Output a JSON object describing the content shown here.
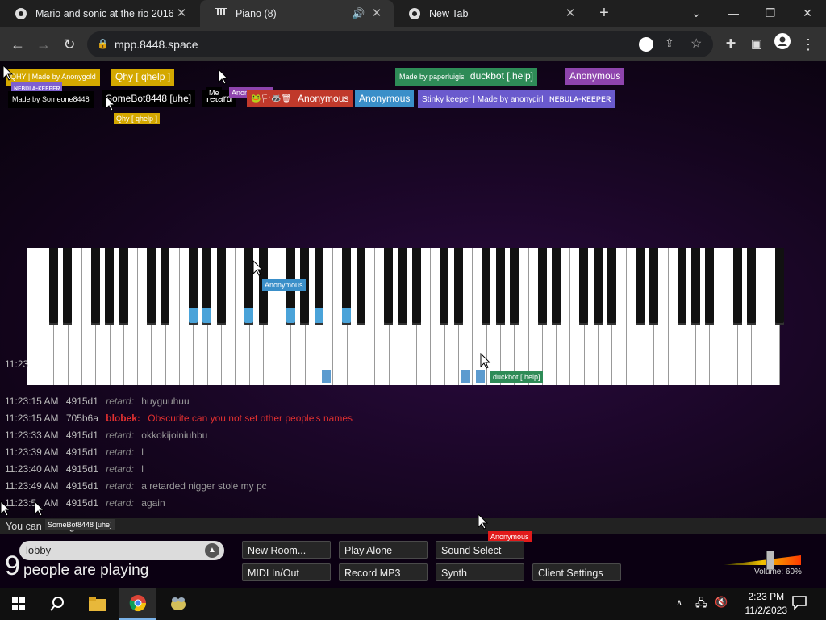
{
  "browser": {
    "tabs": [
      {
        "title": "Mario and sonic at the rio 2016 Olym"
      },
      {
        "title": "Piano (8)"
      },
      {
        "title": "New Tab"
      }
    ],
    "url": "mpp.8448.space"
  },
  "nametags": [
    {
      "text": "QHY | Made by Anonygold",
      "color": "#d4a800"
    },
    {
      "text": "Qhy [ qhelp ]",
      "color": "#d4a800"
    },
    {
      "text": "Made by paperluigis",
      "color": "#2e8b57"
    },
    {
      "text": "duckbot [.help]",
      "color": "#2e8b57"
    },
    {
      "text": "Anonymous",
      "color": "#8e44ad"
    },
    {
      "text": "Made by Someone8448",
      "color": "#000000"
    },
    {
      "text": "SomeBot8448 [uhe]",
      "color": "#000000"
    },
    {
      "text": "retard",
      "color": "#000000"
    },
    {
      "text": "🐸🏳🦝🗑",
      "color": "#c0392b"
    },
    {
      "text": "Anonymous",
      "color": "#c0392b"
    },
    {
      "text": "Anonymous",
      "color": "#3a8fc9"
    },
    {
      "text": "Stinky keeper | Made by anonygirl",
      "color": "#6a5acd"
    },
    {
      "text": "ɴᴇʙᴜʟᴀ-ᴋᴇᴇᴘᴇʀ",
      "color": "#6a5acd"
    }
  ],
  "cursor_tags": [
    {
      "text": "ɴᴇʙᴜʟᴀ-ᴋᴇᴇᴘᴇʀ",
      "color": "#7d5fd0"
    },
    {
      "text": "Me",
      "color": "#000000"
    },
    {
      "text": "Anonymous",
      "color": "#8e44ad"
    },
    {
      "text": "Qhy [ qhelp ]",
      "color": "#d4a800"
    },
    {
      "text": "Anonymous",
      "color": "#3a8fc9"
    },
    {
      "text": "duckbot [.help]",
      "color": "#2e8b57"
    },
    {
      "text": "SomeBot8448 [uhe]",
      "color": "#333333"
    },
    {
      "text": "Anonymous",
      "color": "#e21b1b"
    }
  ],
  "chat": [
    {
      "time": "11:23",
      "id": "",
      "name": "",
      "msg": ""
    },
    {
      "time": "11:23:15 AM",
      "id": "4915d1",
      "name": "retard:",
      "msg": "huyguuhuu",
      "name_color": "#888888",
      "msg_color": "#999999"
    },
    {
      "time": "11:23:15 AM",
      "id": "705b6a",
      "name": "blobek:",
      "msg": "Obscurite can you not set other people's names",
      "name_color": "#e03030",
      "msg_color": "#e03030"
    },
    {
      "time": "11:23:33 AM",
      "id": "4915d1",
      "name": "retard:",
      "msg": "okkokijoiniuhbu",
      "name_color": "#888888",
      "msg_color": "#999999"
    },
    {
      "time": "11:23:39 AM",
      "id": "4915d1",
      "name": "retard:",
      "msg": "l",
      "name_color": "#888888",
      "msg_color": "#999999"
    },
    {
      "time": "11:23:40 AM",
      "id": "4915d1",
      "name": "retard:",
      "msg": "l",
      "name_color": "#888888",
      "msg_color": "#999999"
    },
    {
      "time": "11:23:49 AM",
      "id": "4915d1",
      "name": "retard:",
      "msg": "a retarded nigger stole my pc",
      "name_color": "#888888",
      "msg_color": "#999999"
    },
    {
      "time": "11:23:5_ AM",
      "id": "4915d1",
      "name": "retard:",
      "msg": "again",
      "name_color": "#888888",
      "msg_color": "#999999"
    }
  ],
  "chat_hint": "You can ... hing.",
  "room": {
    "name": "lobby"
  },
  "players": {
    "count": "9",
    "label": "people are playing"
  },
  "buttons": {
    "new_room": "New Room...",
    "play_alone": "Play Alone",
    "sound_select": "Sound Select",
    "midi": "MIDI In/Out",
    "record": "Record MP3",
    "synth": "Synth",
    "client_settings": "Client Settings"
  },
  "volume": {
    "label": "Volume: 60%",
    "level": 0.6
  },
  "taskbar": {
    "time": "2:23 PM",
    "date": "11/2/2023"
  },
  "piano": {
    "lit_black": [
      7,
      8,
      10,
      12,
      14,
      15
    ],
    "lit_white": [
      21,
      31,
      32
    ]
  }
}
